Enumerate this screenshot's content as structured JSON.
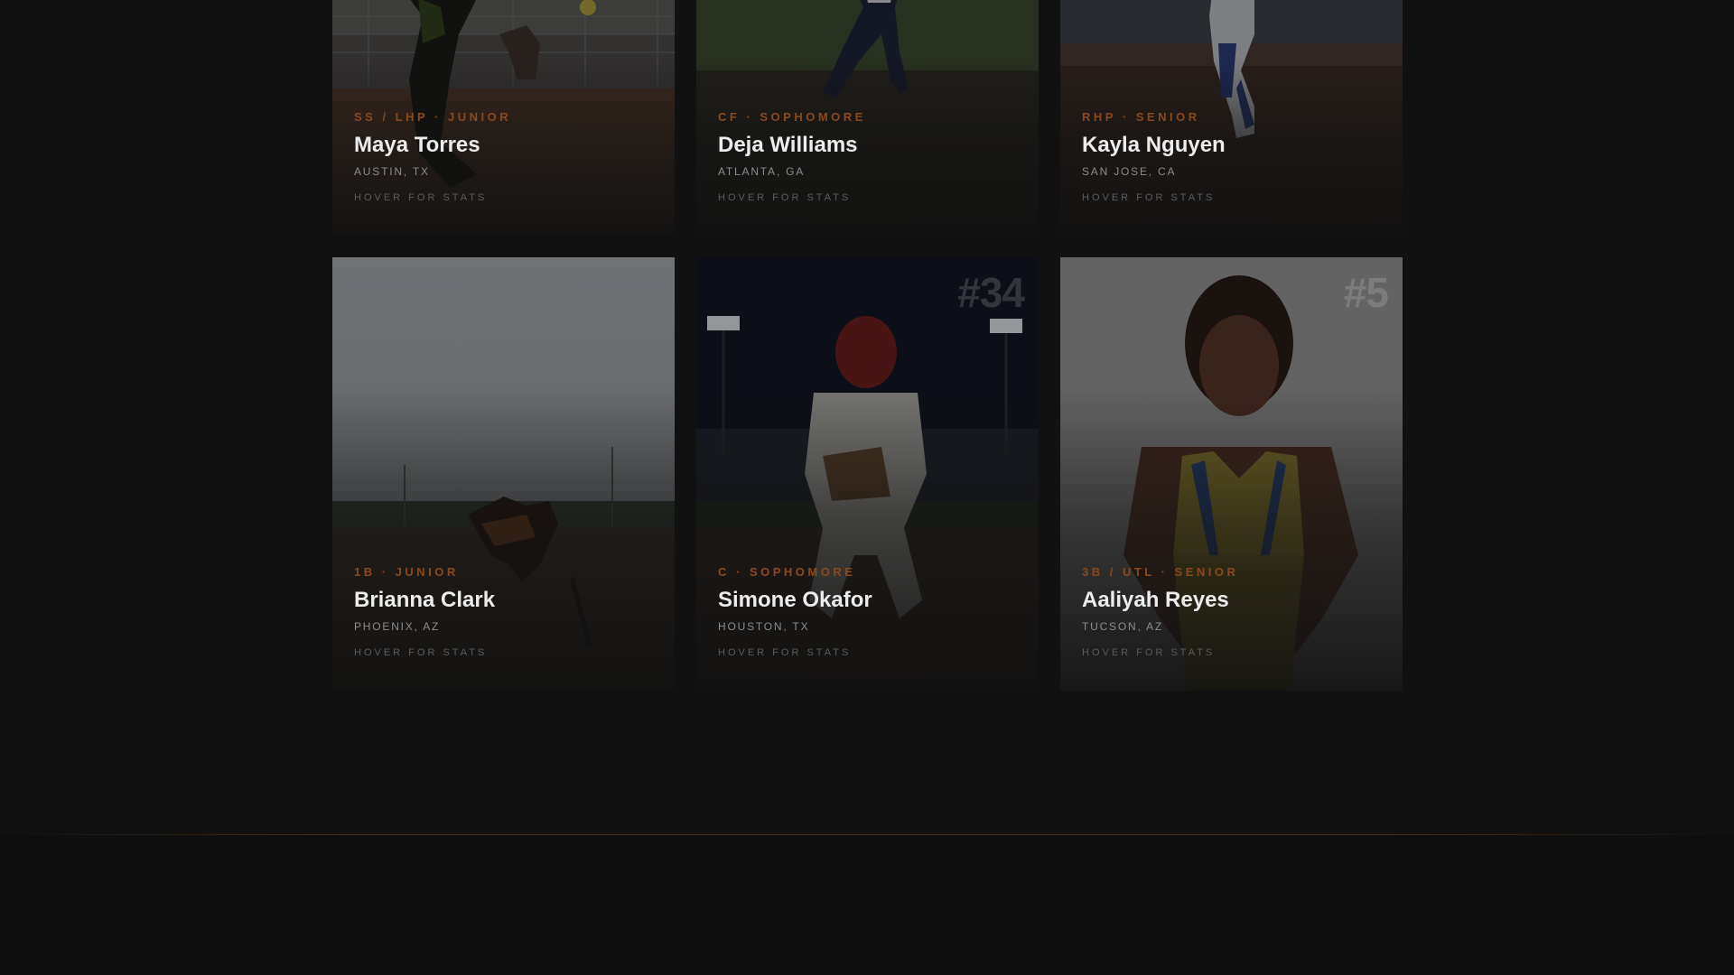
{
  "roster": {
    "cards": [
      {
        "jersey": "",
        "position": "SS / LHP · JUNIOR",
        "name": "Maya Torres",
        "hometown": "AUSTIN, TX",
        "hint": "HOVER FOR STATS"
      },
      {
        "jersey": "",
        "position": "CF · SOPHOMORE",
        "name": "Deja Williams",
        "hometown": "ATLANTA, GA",
        "hint": "HOVER FOR STATS"
      },
      {
        "jersey": "",
        "position": "RHP · SENIOR",
        "name": "Kayla Nguyen",
        "hometown": "SAN JOSE, CA",
        "hint": "HOVER FOR STATS"
      },
      {
        "jersey": "",
        "position": "1B · JUNIOR",
        "name": "Brianna Clark",
        "hometown": "PHOENIX, AZ",
        "hint": "HOVER FOR STATS"
      },
      {
        "jersey": "#34",
        "position": "C · SOPHOMORE",
        "name": "Simone Okafor",
        "hometown": "HOUSTON, TX",
        "hint": "HOVER FOR STATS"
      },
      {
        "jersey": "#5",
        "position": "3B / UTL · SENIOR",
        "name": "Aaliyah Reyes",
        "hometown": "TUCSON, AZ",
        "hint": "HOVER FOR STATS"
      }
    ]
  },
  "colors": {
    "background": "#111111",
    "accent": "#8a4a1e",
    "name_text": "#ececec",
    "muted_text": "#8d8d8d"
  }
}
